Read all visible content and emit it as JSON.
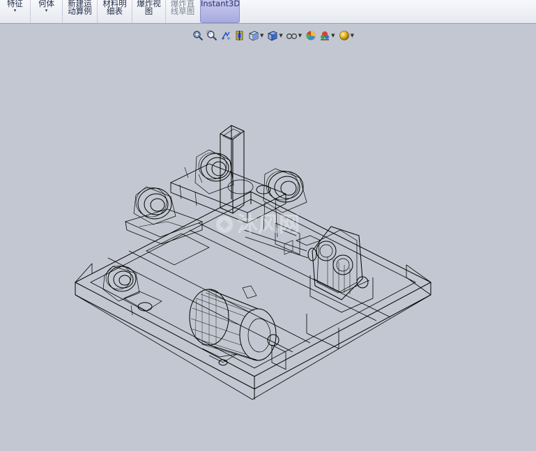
{
  "ribbon": {
    "items": [
      {
        "line1": "特征",
        "line2": "",
        "arrow": "▾"
      },
      {
        "line1": "何体",
        "line2": "",
        "arrow": "▾"
      },
      {
        "line1": "新建运",
        "line2": "动算例"
      },
      {
        "line1": "材料明",
        "line2": "细表"
      },
      {
        "line1": "爆炸视",
        "line2": "图"
      },
      {
        "line1": "爆炸直",
        "line2": "线草图"
      },
      {
        "line1": "Instant3D",
        "line2": ""
      }
    ]
  },
  "view_toolbar": {
    "icons": [
      "zoom-to-fit-icon",
      "zoom-to-area-icon",
      "previous-view-icon",
      "section-view-icon",
      "view-orientation-icon",
      "display-style-icon",
      "hide-show-items-icon",
      "edit-appearance-icon",
      "apply-scene-icon",
      "view-settings-icon"
    ]
  },
  "watermark": "沐风网",
  "colors": {
    "viewport": "#c3c7d1",
    "ribbon_active": "#a8aade",
    "wireframe": "#000000"
  }
}
